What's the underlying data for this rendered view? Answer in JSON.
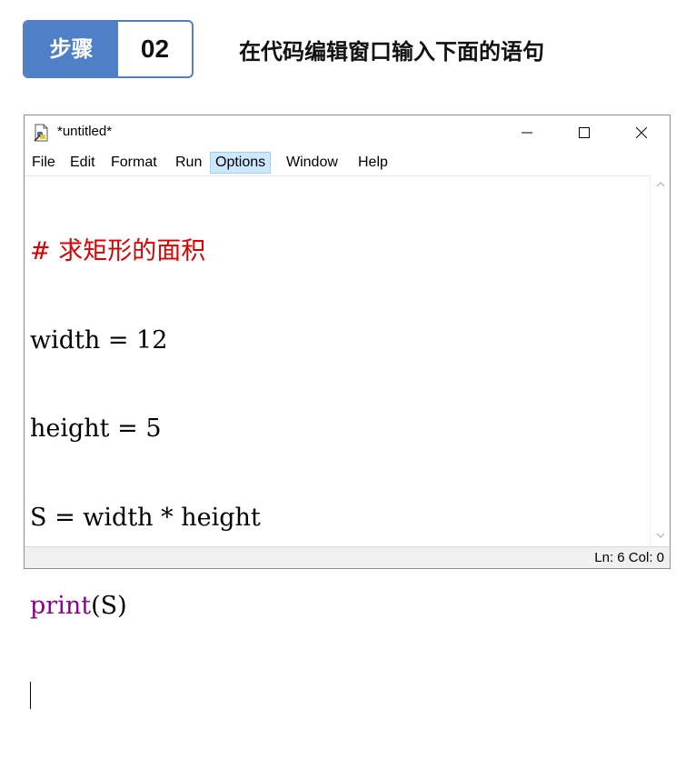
{
  "step": {
    "label": "步骤",
    "number": "02",
    "caption": "在代码编辑窗口输入下面的语句"
  },
  "window": {
    "title": "*untitled*",
    "controls": {
      "minimize": "−",
      "maximize": "☐",
      "close": "✕"
    }
  },
  "menu": {
    "items": [
      "File",
      "Edit",
      "Format",
      "Run",
      "Options",
      "Window",
      "Help"
    ],
    "active": "Options"
  },
  "code": {
    "comment": "# 求矩形的面积",
    "line2": "width = 12",
    "line3": "height = 5",
    "line4": "S = width * height",
    "line5_builtin": "print",
    "line5_rest": "(S)"
  },
  "status": {
    "ln_col": "Ln: 6  Col: 0"
  },
  "colors": {
    "accent": "#4f7fc6",
    "comment": "#dd0000",
    "builtin": "#900090",
    "menu_active": "#cce8ff"
  },
  "icons": {
    "app": "python-file-icon",
    "scroll_up": "chevron-up-icon",
    "scroll_down": "chevron-down-icon"
  }
}
